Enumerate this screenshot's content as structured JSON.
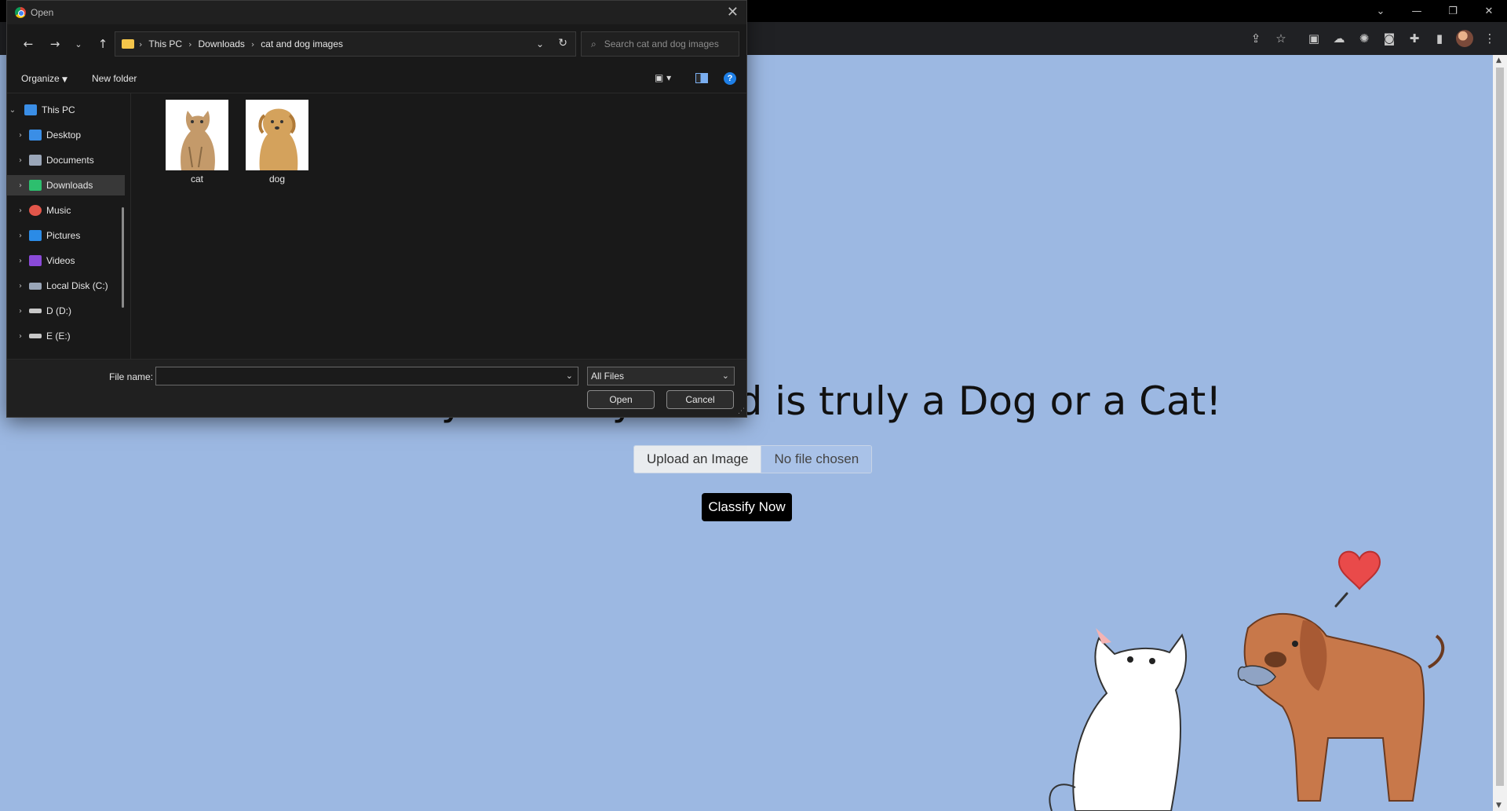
{
  "browser": {
    "window_controls": [
      "⌄",
      "—",
      "❐",
      "✕"
    ],
    "toolbar_icons": [
      "share-icon",
      "star-icon",
      "extension-k-icon",
      "cloud-extension-icon",
      "openai-extension-icon",
      "camera-extension-icon",
      "puzzle-icon",
      "sidepanel-icon",
      "profile-avatar",
      "menu-icon"
    ]
  },
  "page": {
    "headline": "Find out your furry friend is truly a Dog or a Cat!",
    "upload_button": "Upload an Image",
    "file_status": "No file chosen",
    "classify_button": "Classify Now"
  },
  "dialog": {
    "title": "Open",
    "breadcrumb": [
      "This PC",
      "Downloads",
      "cat and dog images"
    ],
    "search_placeholder": "Search cat and dog images",
    "organize": "Organize",
    "new_folder": "New folder",
    "nav_items": [
      {
        "label": "This PC",
        "color": "#3a8ee6",
        "expanded": true
      },
      {
        "label": "Desktop",
        "color": "#3a8ee6"
      },
      {
        "label": "Documents",
        "color": "#9aa6b8"
      },
      {
        "label": "Downloads",
        "color": "#2dbf6e",
        "selected": true
      },
      {
        "label": "Music",
        "color": "#e2564a"
      },
      {
        "label": "Pictures",
        "color": "#2b8be6"
      },
      {
        "label": "Videos",
        "color": "#8a4ad8"
      },
      {
        "label": "Local Disk (C:)",
        "color": "#9aa6b8"
      },
      {
        "label": "D (D:)",
        "color": "#c8c8c8"
      },
      {
        "label": "E (E:)",
        "color": "#c8c8c8"
      }
    ],
    "files": [
      {
        "name": "cat",
        "kind": "cat-photo"
      },
      {
        "name": "dog",
        "kind": "dog-photo"
      }
    ],
    "file_name_label": "File name:",
    "file_name_value": "",
    "file_type": "All Files",
    "open_button": "Open",
    "cancel_button": "Cancel"
  },
  "colors": {
    "page_bg": "#9cb8e2",
    "dialog_bg": "#191919",
    "accent": "#1e7fe6"
  }
}
